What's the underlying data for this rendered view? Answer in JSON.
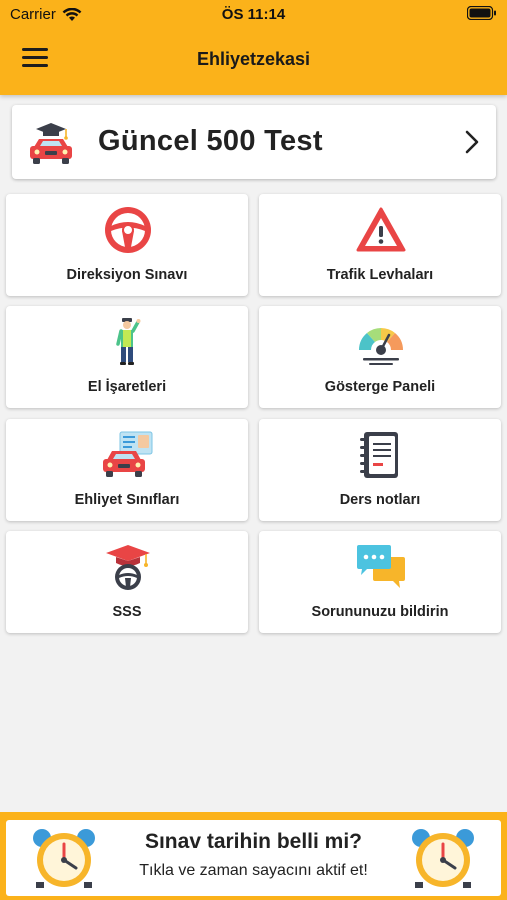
{
  "status_bar": {
    "carrier": "Carrier",
    "time": "ÖS 11:14"
  },
  "navbar": {
    "title": "Ehliyetzekasi"
  },
  "feature": {
    "title": "Güncel 500 Test"
  },
  "grid": [
    {
      "label": "Direksiyon Sınavı",
      "icon": "steering-wheel-icon"
    },
    {
      "label": "Trafik Levhaları",
      "icon": "warning-sign-icon"
    },
    {
      "label": "El İşaretleri",
      "icon": "traffic-police-icon"
    },
    {
      "label": "Gösterge Paneli",
      "icon": "gauge-icon"
    },
    {
      "label": "Ehliyet Sınıfları",
      "icon": "license-car-icon"
    },
    {
      "label": "Ders notları",
      "icon": "notebook-icon"
    },
    {
      "label": "SSS",
      "icon": "graduation-wheel-icon"
    },
    {
      "label": "Sorununuzu bildirin",
      "icon": "chat-bubbles-icon"
    }
  ],
  "banner": {
    "headline": "Sınav tarihin belli mi?",
    "subtext": "Tıkla ve zaman sayacını aktif et!"
  },
  "colors": {
    "accent": "#fbb21a",
    "red": "#e94545",
    "background": "#f2f2f2"
  }
}
